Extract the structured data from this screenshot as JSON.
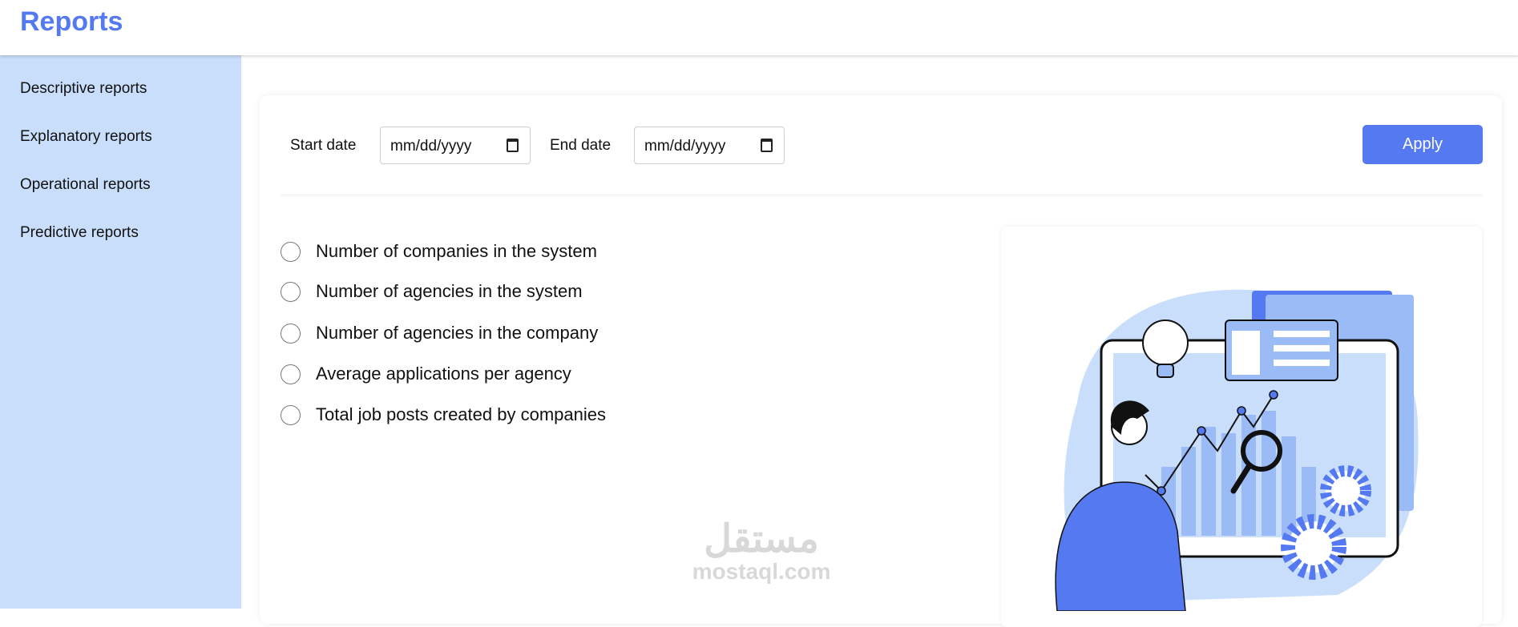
{
  "header": {
    "title": "Reports"
  },
  "sidebar": {
    "items": [
      {
        "label": "Descriptive reports"
      },
      {
        "label": "Explanatory reports"
      },
      {
        "label": "Operational reports"
      },
      {
        "label": "Predictive reports"
      }
    ]
  },
  "filters": {
    "start_label": "Start date",
    "start_value": "mm/dd/yyyy",
    "end_label": "End date",
    "end_value": "mm/dd/yyyy",
    "apply_label": "Apply"
  },
  "options": [
    {
      "label": "Number of companies in the system"
    },
    {
      "label": "Number of agencies in the system"
    },
    {
      "label": "Number of agencies in the company"
    },
    {
      "label": "Average applications per agency"
    },
    {
      "label": "Total job posts created by companies"
    }
  ],
  "watermark": {
    "arabic": "مستقل",
    "latin": "mostaql.com"
  },
  "colors": {
    "accent": "#5479f0",
    "sidebar": "#c9defb"
  }
}
